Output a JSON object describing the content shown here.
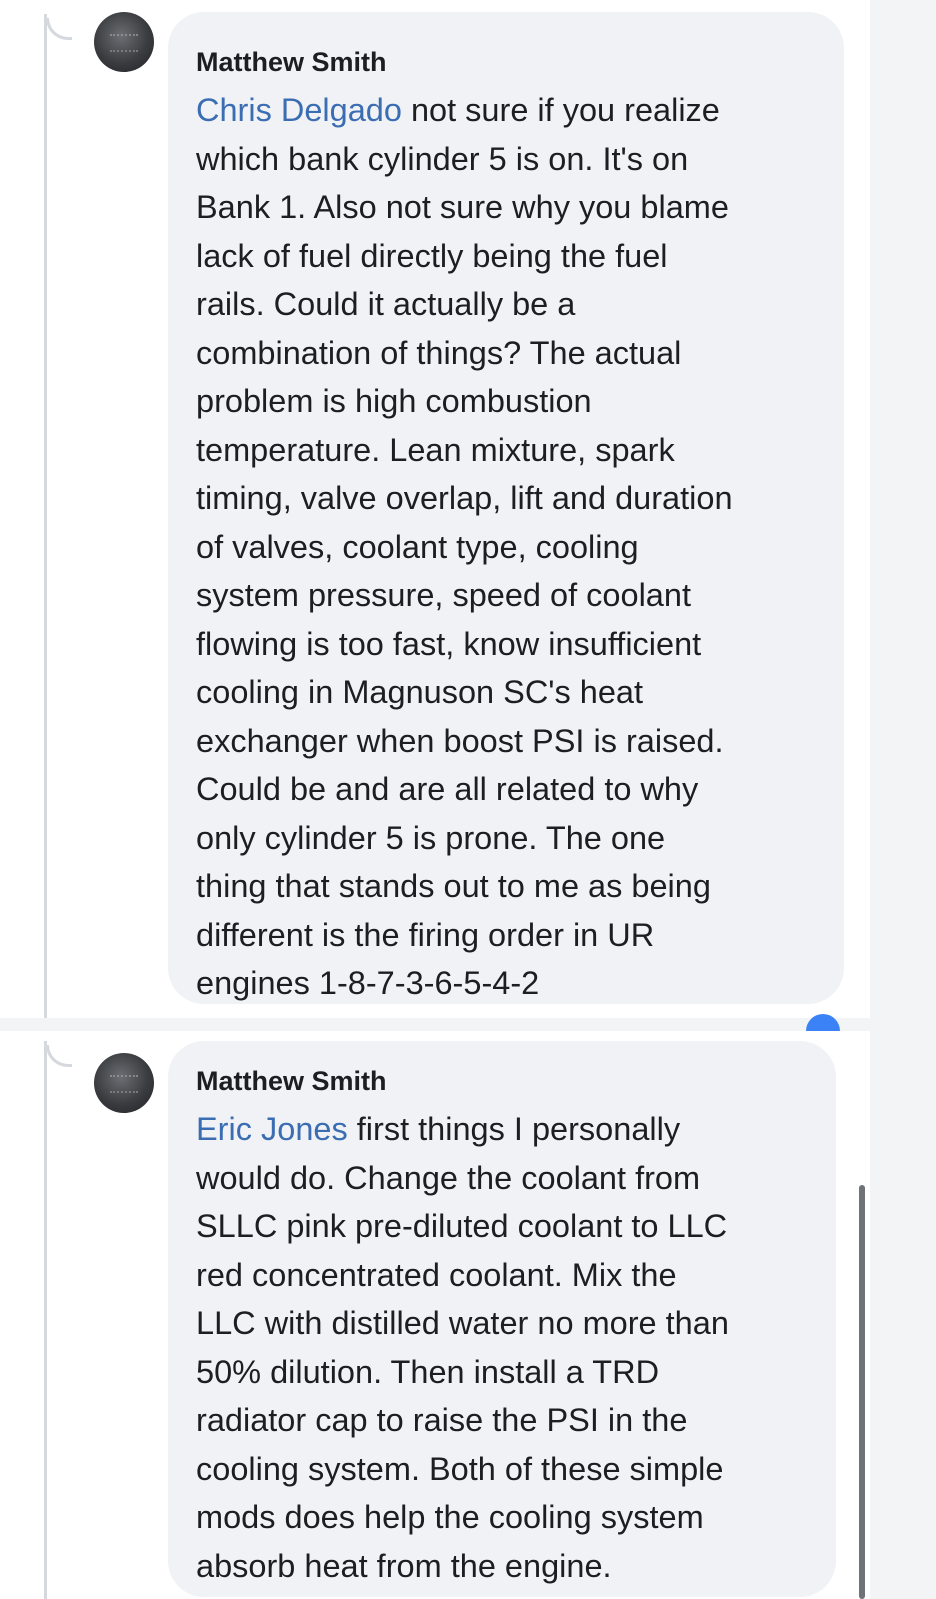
{
  "comments": [
    {
      "author": "Matthew Smith",
      "mention": "Chris Delgado",
      "first_line_rest": " not sure if you realize",
      "lines": [
        "which bank cylinder 5 is on. It's on",
        "Bank 1. Also not sure why you blame",
        "lack of fuel directly being the fuel",
        "rails. Could it actually be a",
        "combination of things? The actual",
        "problem is high combustion",
        "temperature. Lean mixture, spark",
        "timing, valve overlap, lift and duration",
        "of valves, coolant type, cooling",
        "system pressure, speed of coolant",
        "flowing is too fast, know insufficient",
        "cooling in Magnuson SC's heat",
        "exchanger when boost PSI is raised.",
        "Could be and are all related to why",
        "only cylinder 5 is prone. The one",
        "thing that stands out to me as being",
        "different is the firing order in UR",
        "engines 1-8-7-3-6-5-4-2"
      ]
    },
    {
      "author": "Matthew Smith",
      "mention": "Eric Jones",
      "first_line_rest": " first things I personally",
      "lines": [
        "would do. Change the coolant from",
        "SLLC pink pre-diluted coolant to LLC",
        "red concentrated coolant. Mix the",
        "LLC with distilled water no more than",
        "50% dilution. Then install a TRD",
        "radiator cap to raise the PSI in the",
        "cooling system. Both of these simple",
        "mods does help the cooling system",
        "absorb  heat from the engine."
      ]
    }
  ],
  "colors": {
    "mention": "#3b6db3",
    "bubble": "#f0f2f5",
    "text": "#1c1e21"
  }
}
